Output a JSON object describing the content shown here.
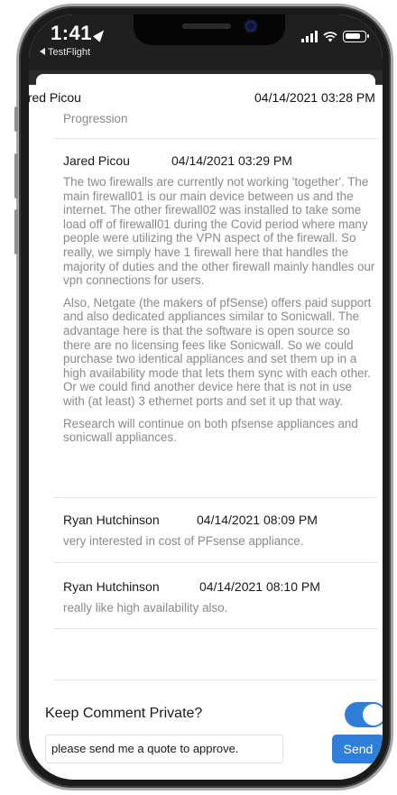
{
  "status_bar": {
    "time": "1:41",
    "back_app": "TestFlight",
    "icons": [
      "location-arrow-icon",
      "signal-icon",
      "wifi-icon",
      "battery-icon"
    ]
  },
  "top_entry": {
    "author": "Jared Picou",
    "date": "04/14/2021 03:28 PM",
    "text": "Progression"
  },
  "comments": [
    {
      "author": "Jared Picou",
      "date": "04/14/2021 03:29 PM",
      "paragraphs": [
        "The two firewalls are currently not working 'together'. The main firewall01 is our main device between us and the internet.  The other firewall02 was installed to take some load off of firewall01 during the Covid period where many people were utilizing the VPN aspect of the firewall.  So really, we simply have 1 firewall here that handles the majority of duties and the other firewall mainly handles our vpn connections for users.",
        "Also, Netgate (the makers of pfSense) offers paid support and also dedicated appliances similar to Sonicwall.  The advantage here is that the software is open source so there are no licensing fees like Sonicwall.  So we could purchase two identical appliances and set them up in a high availability mode that lets them sync with each other.  Or we could find another device here that is not in use with (at least) 3 ethernet ports and set it up that way.",
        "Research will continue on both pfsense appliances and sonicwall appliances."
      ]
    },
    {
      "author": "Ryan Hutchinson",
      "date": "04/14/2021 08:09 PM",
      "paragraphs": [
        "very interested in cost of PFsense appliance."
      ]
    },
    {
      "author": "Ryan Hutchinson",
      "date": "04/14/2021 08:10 PM",
      "paragraphs": [
        "really like high availability also."
      ]
    }
  ],
  "compose": {
    "private_label": "Keep Comment Private?",
    "private_on": true,
    "input_value": "please send me a quote to approve.",
    "send_label": "Send"
  },
  "colors": {
    "accent": "#2f7fd8",
    "muted_text": "#8a8a8a",
    "frame": "#1b1b1b"
  }
}
